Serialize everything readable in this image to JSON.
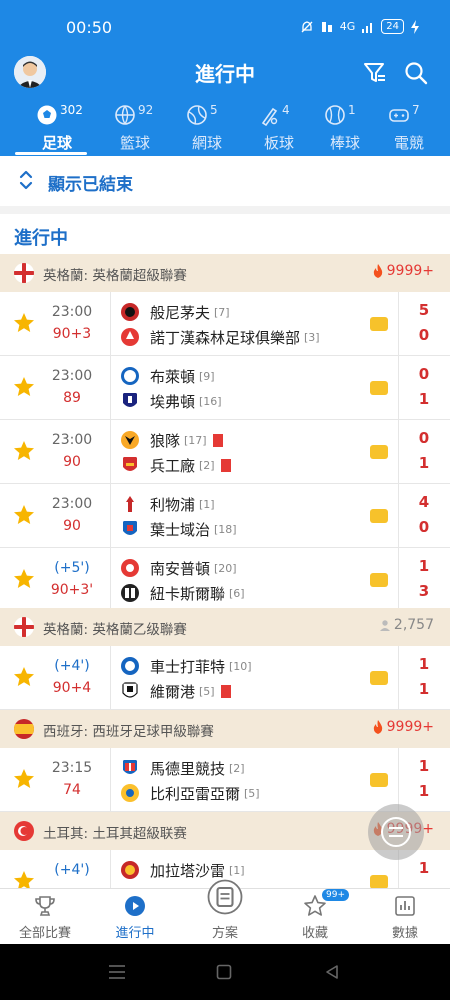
{
  "status_bar": {
    "time": "00:50",
    "signal": "4G",
    "battery": "24"
  },
  "header": {
    "title": "進行中"
  },
  "tabs": [
    {
      "label": "足球",
      "count": "302"
    },
    {
      "label": "籃球",
      "count": "92"
    },
    {
      "label": "網球",
      "count": "5"
    },
    {
      "label": "板球",
      "count": "4"
    },
    {
      "label": "棒球",
      "count": "1"
    },
    {
      "label": "電競",
      "count": "7"
    }
  ],
  "show_ended": "顯示已結束",
  "section_title": "進行中",
  "leagues": [
    {
      "name": "英格蘭: 英格蘭超級聯賽",
      "hot": "9999+"
    },
    {
      "name": "英格蘭: 英格蘭乙级聯賽",
      "hot": "2,757"
    },
    {
      "name": "西班牙: 西班牙足球甲級聯賽",
      "hot": "9999+"
    },
    {
      "name": "土耳其: 土耳其超級联赛",
      "hot": "9999+"
    }
  ],
  "matches": [
    {
      "time": "23:00",
      "minute": "90+3",
      "home": "般尼茅夫",
      "home_rank": "[7]",
      "away": "諾丁漢森林足球俱樂部",
      "away_rank": "[3]",
      "home_score": "5",
      "away_score": "0"
    },
    {
      "time": "23:00",
      "minute": "89",
      "home": "布萊頓",
      "home_rank": "[9]",
      "away": "埃弗頓",
      "away_rank": "[16]",
      "home_score": "0",
      "away_score": "1"
    },
    {
      "time": "23:00",
      "minute": "90",
      "home": "狼隊",
      "home_rank": "[17]",
      "away": "兵工廠",
      "away_rank": "[2]",
      "home_score": "0",
      "away_score": "1"
    },
    {
      "time": "23:00",
      "minute": "90",
      "home": "利物浦",
      "home_rank": "[1]",
      "away": "葉士域治",
      "away_rank": "[18]",
      "home_score": "4",
      "away_score": "0"
    },
    {
      "time": "(+5')",
      "minute": "90+3'",
      "home": "南安普頓",
      "home_rank": "[20]",
      "away": "紐卡斯爾聯",
      "away_rank": "[6]",
      "home_score": "1",
      "away_score": "3"
    },
    {
      "time": "(+4')",
      "minute": "90+4",
      "home": "車士打菲特",
      "home_rank": "[10]",
      "away": "維爾港",
      "away_rank": "[5]",
      "home_score": "1",
      "away_score": "1"
    },
    {
      "time": "23:15",
      "minute": "74",
      "home": "馬德里競技",
      "home_rank": "[2]",
      "away": "比利亞雷亞爾",
      "away_rank": "[5]",
      "home_score": "1",
      "away_score": "1"
    },
    {
      "time": "(+4')",
      "minute": "",
      "home": "加拉塔沙雷",
      "home_rank": "[1]",
      "away": "",
      "away_rank": "",
      "home_score": "1",
      "away_score": ""
    }
  ],
  "bottom_nav": [
    {
      "label": "全部比賽"
    },
    {
      "label": "進行中"
    },
    {
      "label": "方案"
    },
    {
      "label": "收藏",
      "badge": "99+"
    },
    {
      "label": "數據"
    }
  ],
  "colors": {
    "primary": "#1e88e5",
    "accent_red": "#d32f2f",
    "star": "#f7b500",
    "league_bg": "#f3e9d9"
  }
}
